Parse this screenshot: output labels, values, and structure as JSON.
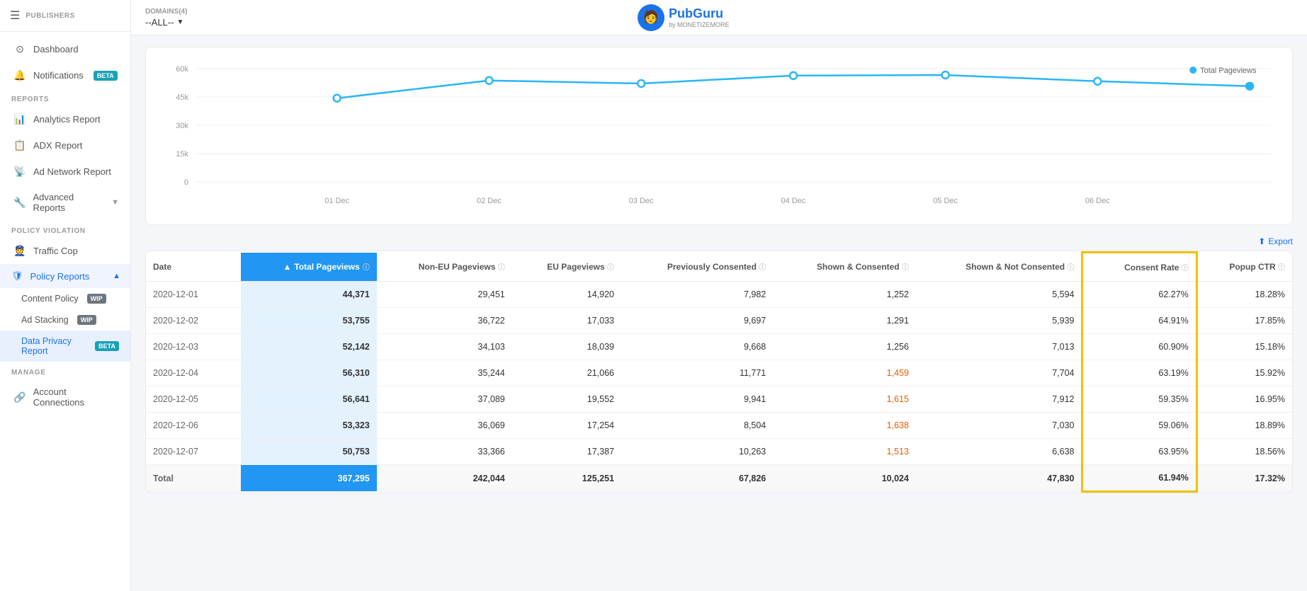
{
  "sidebar": {
    "publishers_label": "PUBLISHERS",
    "nav_items": [
      {
        "id": "dashboard",
        "label": "Dashboard",
        "icon": "⊙"
      },
      {
        "id": "notifications",
        "label": "Notifications",
        "icon": "🔔",
        "badge": "BETA",
        "badge_type": "beta"
      }
    ],
    "reports_section": "REPORTS",
    "reports_items": [
      {
        "id": "analytics",
        "label": "Analytics Report",
        "icon": "📊"
      },
      {
        "id": "adx",
        "label": "ADX Report",
        "icon": "📋"
      },
      {
        "id": "adnetwork",
        "label": "Ad Network Report",
        "icon": "📡"
      },
      {
        "id": "advanced",
        "label": "Advanced Reports",
        "icon": "🔧",
        "has_arrow": true
      }
    ],
    "policy_section": "POLICY VIOLATION",
    "policy_items": [
      {
        "id": "trafficcop",
        "label": "Traffic Cop",
        "icon": "👮"
      }
    ],
    "policy_reports_group": {
      "label": "Policy Reports",
      "icon": "🛡",
      "items": [
        {
          "id": "content-policy",
          "label": "Content Policy",
          "badge": "WIP",
          "badge_type": "wip"
        },
        {
          "id": "ad-stacking",
          "label": "Ad Stacking",
          "badge": "WIP",
          "badge_type": "wip"
        },
        {
          "id": "data-privacy",
          "label": "Data Privacy Report",
          "badge": "BETA",
          "badge_type": "beta",
          "active": true
        }
      ]
    },
    "manage_section": "MANAGE",
    "manage_items": [
      {
        "id": "account-connections",
        "label": "Account Connections",
        "icon": "🔗"
      }
    ]
  },
  "topbar": {
    "domains_label": "DOMAINS(4)",
    "domains_value": "--ALL--",
    "logo_text": "PubGuru",
    "logo_sub": "by MONETIZEMORE"
  },
  "chart": {
    "y_labels": [
      "0",
      "15k",
      "30k",
      "45k",
      "60k"
    ],
    "x_labels": [
      "01 Dec",
      "02 Dec",
      "03 Dec",
      "04 Dec",
      "05 Dec",
      "06 Dec"
    ],
    "legend": "Total Pageviews",
    "data_points": [
      44371,
      53755,
      52142,
      56310,
      56641,
      53323,
      50753
    ]
  },
  "export_label": "Export",
  "table": {
    "columns": [
      {
        "id": "date",
        "label": "Date",
        "highlight": false
      },
      {
        "id": "total_pv",
        "label": "Total Pageviews",
        "highlight": true
      },
      {
        "id": "non_eu",
        "label": "Non-EU Pageviews",
        "highlight": false
      },
      {
        "id": "eu",
        "label": "EU Pageviews",
        "highlight": false
      },
      {
        "id": "prev_consented",
        "label": "Previously Consented",
        "highlight": false
      },
      {
        "id": "shown_consented",
        "label": "Shown & Consented",
        "highlight": false
      },
      {
        "id": "shown_not_consented",
        "label": "Shown & Not Consented",
        "highlight": false
      },
      {
        "id": "consent_rate",
        "label": "Consent Rate",
        "highlight": false,
        "consent_col": true
      },
      {
        "id": "popup_ctr",
        "label": "Popup CTR",
        "highlight": false
      }
    ],
    "rows": [
      {
        "date": "2020-12-01",
        "total_pv": "44,371",
        "non_eu": "29,451",
        "eu": "14,920",
        "prev_consented": "7,982",
        "shown_consented": "1,252",
        "shown_not_consented": "5,594",
        "consent_rate": "62.27%",
        "popup_ctr": "18.28%"
      },
      {
        "date": "2020-12-02",
        "total_pv": "53,755",
        "non_eu": "36,722",
        "eu": "17,033",
        "prev_consented": "9,697",
        "shown_consented": "1,291",
        "shown_not_consented": "5,939",
        "consent_rate": "64.91%",
        "popup_ctr": "17.85%"
      },
      {
        "date": "2020-12-03",
        "total_pv": "52,142",
        "non_eu": "34,103",
        "eu": "18,039",
        "prev_consented": "9,668",
        "shown_consented": "1,256",
        "shown_not_consented": "7,013",
        "consent_rate": "60.90%",
        "popup_ctr": "15.18%"
      },
      {
        "date": "2020-12-04",
        "total_pv": "56,310",
        "non_eu": "35,244",
        "eu": "21,066",
        "prev_consented": "11,771",
        "shown_consented": "1,459",
        "shown_not_consented": "7,704",
        "consent_rate": "63.19%",
        "popup_ctr": "15.92%"
      },
      {
        "date": "2020-12-05",
        "total_pv": "56,641",
        "non_eu": "37,089",
        "eu": "19,552",
        "prev_consented": "9,941",
        "shown_consented": "1,615",
        "shown_not_consented": "7,912",
        "consent_rate": "59.35%",
        "popup_ctr": "16.95%"
      },
      {
        "date": "2020-12-06",
        "total_pv": "53,323",
        "non_eu": "36,069",
        "eu": "17,254",
        "prev_consented": "8,504",
        "shown_consented": "1,638",
        "shown_not_consented": "7,030",
        "consent_rate": "59.06%",
        "popup_ctr": "18.89%"
      },
      {
        "date": "2020-12-07",
        "total_pv": "50,753",
        "non_eu": "33,366",
        "eu": "17,387",
        "prev_consented": "10,263",
        "shown_consented": "1,513",
        "shown_not_consented": "6,638",
        "consent_rate": "63.95%",
        "popup_ctr": "18.56%"
      }
    ],
    "total_row": {
      "label": "Total",
      "total_pv": "367,295",
      "non_eu": "242,044",
      "eu": "125,251",
      "prev_consented": "67,826",
      "shown_consented": "10,024",
      "shown_not_consented": "47,830",
      "consent_rate": "61.94%",
      "popup_ctr": "17.32%"
    }
  }
}
